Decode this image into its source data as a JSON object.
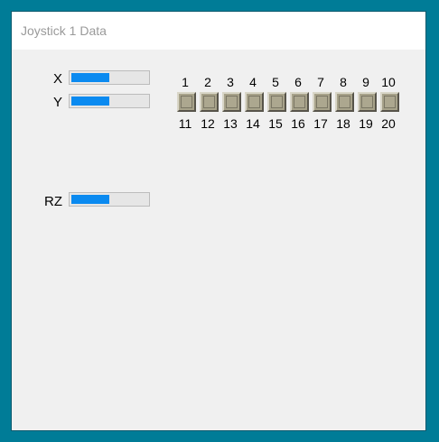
{
  "window": {
    "title": "Joystick 1 Data"
  },
  "axes": [
    {
      "label": "X",
      "value_fraction": 0.5
    },
    {
      "label": "Y",
      "value_fraction": 0.5
    },
    {
      "label": "RZ",
      "value_fraction": 0.5
    }
  ],
  "buttons": {
    "top_labels": [
      "1",
      "2",
      "3",
      "4",
      "5",
      "6",
      "7",
      "8",
      "9",
      "10"
    ],
    "bottom_labels": [
      "11",
      "12",
      "13",
      "14",
      "15",
      "16",
      "17",
      "18",
      "19",
      "20"
    ]
  },
  "colors": {
    "desktop": "#007c97",
    "bar_fill": "#0a8af0",
    "button_face": "#a7a28a"
  }
}
